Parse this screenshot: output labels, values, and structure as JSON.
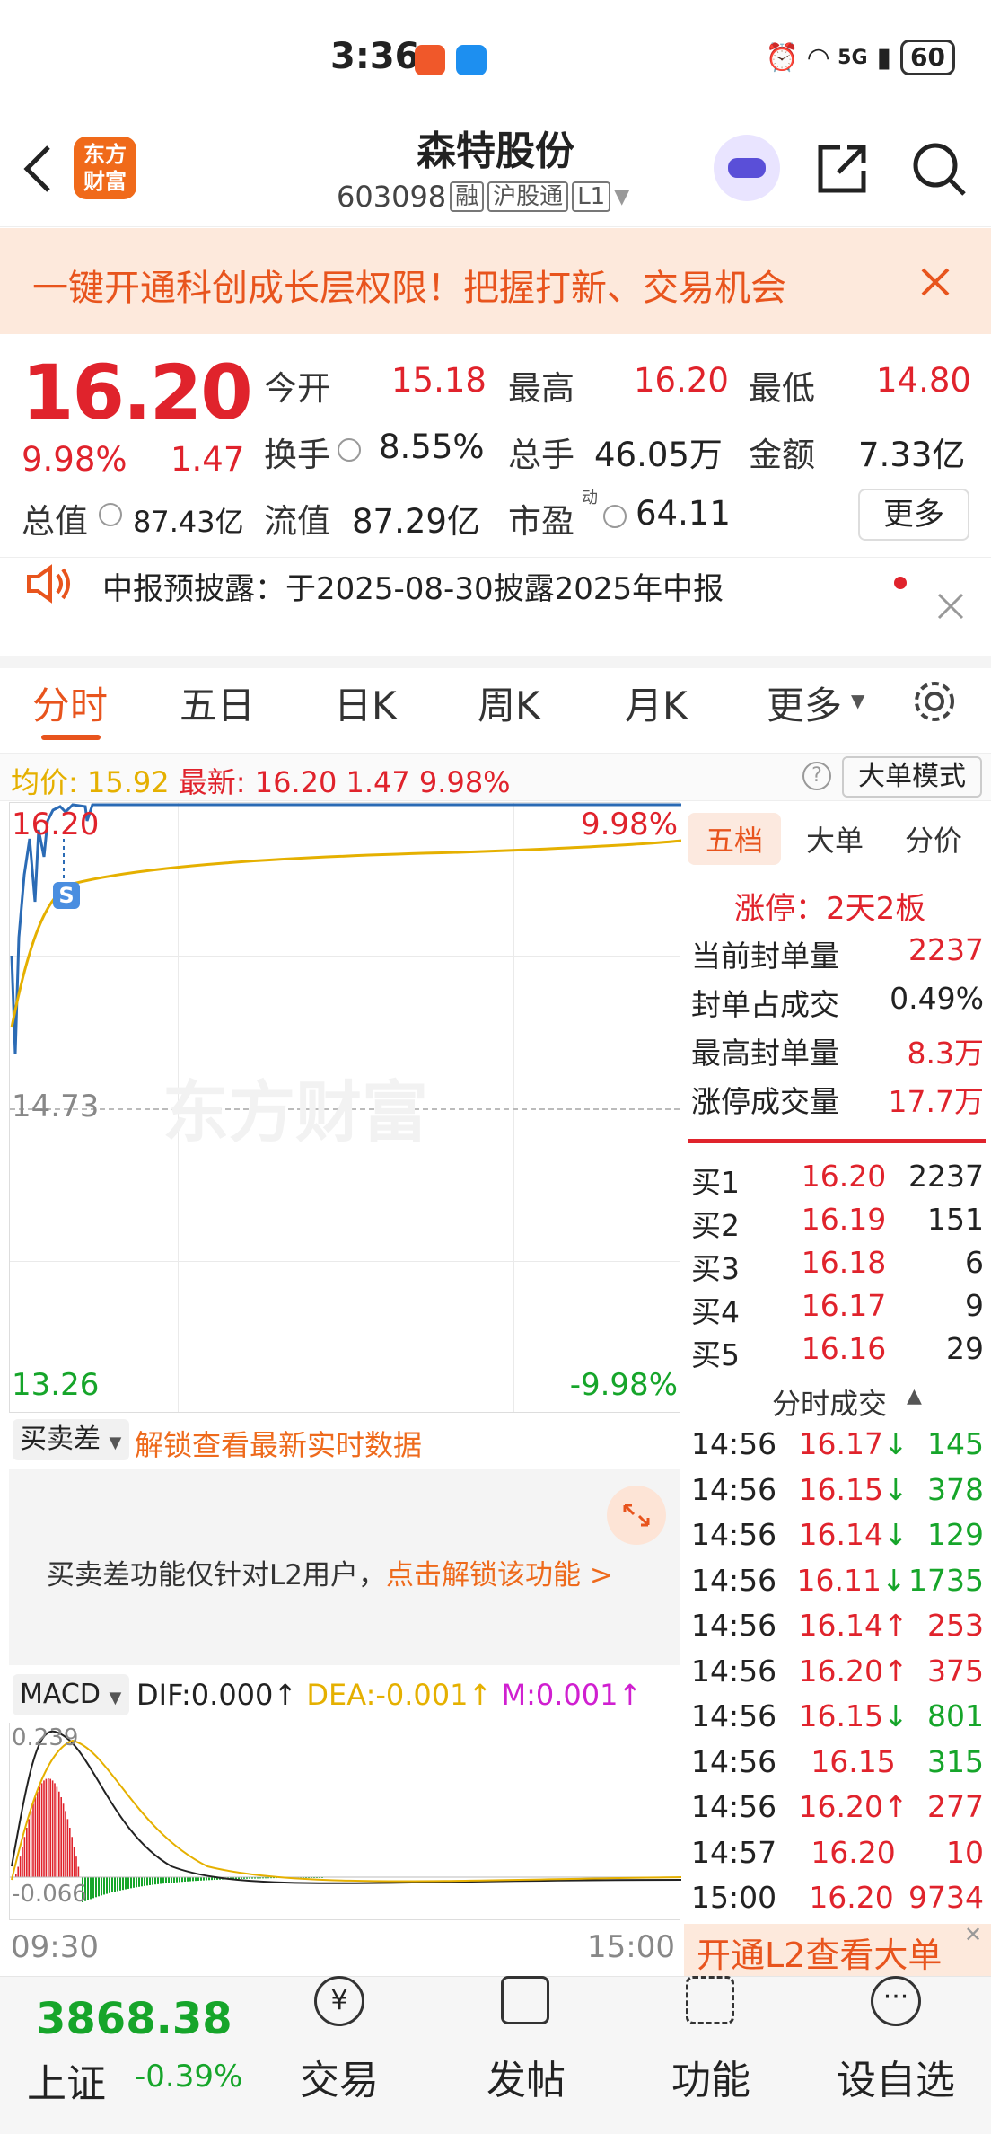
{
  "status_bar": {
    "time": "3:36",
    "network": "5G",
    "battery": "60"
  },
  "header": {
    "title": "森特股份",
    "code": "603098",
    "tags": [
      "融",
      "沪股通",
      "L1"
    ],
    "logo_text_1": "东方",
    "logo_text_2": "财富"
  },
  "banner": {
    "text": "一键开通科创成长层权限！把握打新、交易机会"
  },
  "quote": {
    "price": "16.20",
    "change_pct": "9.98%",
    "change": "1.47",
    "open_label": "今开",
    "open": "15.18",
    "high_label": "最高",
    "high": "16.20",
    "low_label": "最低",
    "low": "14.80",
    "turnover_label": "换手",
    "turnover": "8.55%",
    "volume_label": "总手",
    "volume": "46.05万",
    "amount_label": "金额",
    "amount": "7.33亿",
    "mktcap_label": "总值",
    "mktcap": "87.43亿",
    "float_label": "流值",
    "float": "87.29亿",
    "pe_label": "市盈",
    "pe_sup": "动",
    "pe": "64.11",
    "more_label": "更多"
  },
  "notice": {
    "text": "中报预披露：于2025-08-30披露2025年中报"
  },
  "tabs": [
    "分时",
    "五日",
    "日K",
    "周K",
    "月K",
    "更多"
  ],
  "avg_line": {
    "avg_label": "均价:",
    "avg": "15.92",
    "latest_label": "最新:",
    "latest": "16.20",
    "chg": "1.47",
    "pct": "9.98%",
    "bigorder_btn": "大单模式"
  },
  "chart": {
    "top_left": "16.20",
    "top_right": "9.98%",
    "mid_left": "14.73",
    "bottom_left": "13.26",
    "bottom_right": "-9.98%",
    "watermark": "东方财富",
    "marker": "S",
    "time_start": "09:30",
    "time_end": "15:00"
  },
  "order_panel": {
    "tabs": [
      "五档",
      "大单",
      "分价"
    ],
    "limit_status": "涨停：2天2板",
    "stats": [
      {
        "label": "当前封单量",
        "value": "2237"
      },
      {
        "label": "封单占成交",
        "value": "0.49%"
      },
      {
        "label": "最高封单量",
        "value": "8.3万"
      },
      {
        "label": "涨停成交量",
        "value": "17.7万"
      }
    ],
    "bids": [
      {
        "label": "买1",
        "price": "16.20",
        "vol": "2237"
      },
      {
        "label": "买2",
        "price": "16.19",
        "vol": "151"
      },
      {
        "label": "买3",
        "price": "16.18",
        "vol": "6"
      },
      {
        "label": "买4",
        "price": "16.17",
        "vol": "9"
      },
      {
        "label": "买5",
        "price": "16.16",
        "vol": "29"
      }
    ],
    "ticks_title": "分时成交",
    "ticks": [
      {
        "t": "14:56",
        "p": "16.17",
        "d": "↓",
        "v": "145",
        "c": "green"
      },
      {
        "t": "14:56",
        "p": "16.15",
        "d": "↓",
        "v": "378",
        "c": "green"
      },
      {
        "t": "14:56",
        "p": "16.14",
        "d": "↓",
        "v": "129",
        "c": "green"
      },
      {
        "t": "14:56",
        "p": "16.11",
        "d": "↓",
        "v": "1735",
        "c": "green"
      },
      {
        "t": "14:56",
        "p": "16.14",
        "d": "↑",
        "v": "253",
        "c": "red"
      },
      {
        "t": "14:56",
        "p": "16.20",
        "d": "↑",
        "v": "375",
        "c": "red"
      },
      {
        "t": "14:56",
        "p": "16.15",
        "d": "↓",
        "v": "801",
        "c": "green"
      },
      {
        "t": "14:56",
        "p": "16.15",
        "d": "",
        "v": "315",
        "c": "green"
      },
      {
        "t": "14:56",
        "p": "16.20",
        "d": "↑",
        "v": "277",
        "c": "red"
      },
      {
        "t": "14:57",
        "p": "16.20",
        "d": "",
        "v": "10",
        "c": "red"
      },
      {
        "t": "15:00",
        "p": "16.20",
        "d": "",
        "v": "9734",
        "c": "red"
      }
    ],
    "l2_button": "开通L2查看大单"
  },
  "buysell": {
    "select": "买卖差",
    "unlock_text": "解锁查看最新实时数据",
    "box_text": "买卖差功能仅针对L2用户，",
    "box_link": "点击解锁该功能 >"
  },
  "macd": {
    "select": "MACD",
    "dif": "DIF:0.000",
    "dea": "DEA:-0.001",
    "m": "M:0.001",
    "top": "0.239",
    "bottom": "-0.066"
  },
  "bottom_nav": {
    "index_value": "3868.38",
    "index_name": "上证",
    "index_change": "-0.39%",
    "items": [
      "交易",
      "发帖",
      "功能",
      "设自选"
    ]
  },
  "colors": {
    "up": "#e0232c",
    "down": "#16a52a",
    "accent": "#e8541d"
  }
}
